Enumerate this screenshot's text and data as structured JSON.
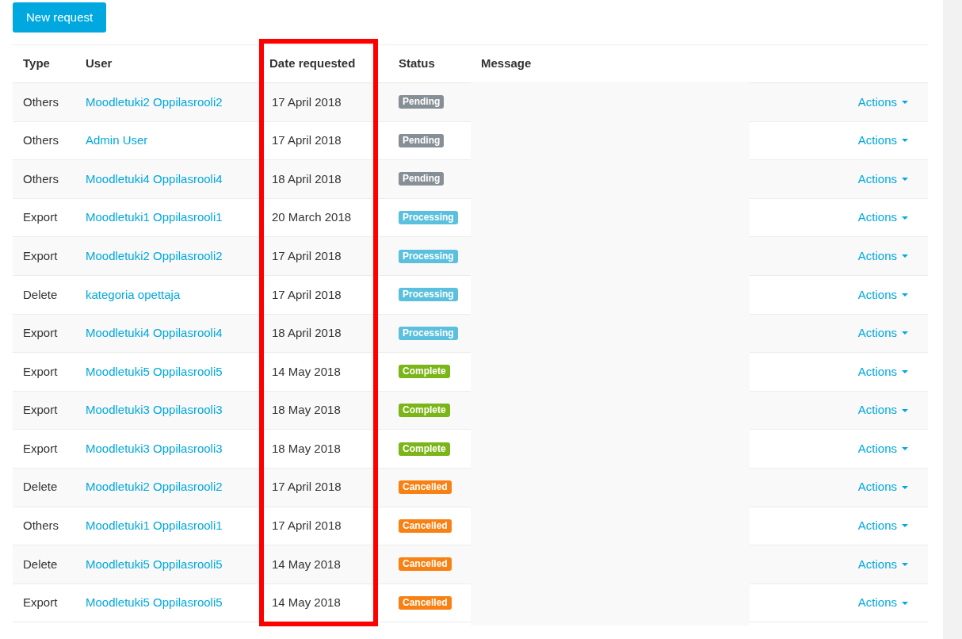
{
  "new_request_button": "New request",
  "table": {
    "columns": [
      {
        "label": "Type",
        "highlighted": false
      },
      {
        "label": "User",
        "highlighted": false
      },
      {
        "label": "Date requested",
        "highlighted": true
      },
      {
        "label": "Status",
        "highlighted": false
      },
      {
        "label": "Message",
        "highlighted": false
      }
    ],
    "rows": [
      {
        "type": "Others",
        "user": "Moodletuki2 Oppilasrooli2",
        "date": "17 April 2018",
        "status": {
          "label": "Pending",
          "color": "#868e96"
        },
        "actions": "Actions"
      },
      {
        "type": "Others",
        "user": "Admin User",
        "date": "17 April 2018",
        "status": {
          "label": "Pending",
          "color": "#868e96"
        },
        "actions": "Actions"
      },
      {
        "type": "Others",
        "user": "Moodletuki4 Oppilasrooli4",
        "date": "18 April 2018",
        "status": {
          "label": "Pending",
          "color": "#868e96"
        },
        "actions": "Actions"
      },
      {
        "type": "Export",
        "user": "Moodletuki1 Oppilasrooli1",
        "date": "20 March 2018",
        "status": {
          "label": "Processing",
          "color": "#5bc0de"
        },
        "actions": "Actions"
      },
      {
        "type": "Export",
        "user": "Moodletuki2 Oppilasrooli2",
        "date": "17 April 2018",
        "status": {
          "label": "Processing",
          "color": "#5bc0de"
        },
        "actions": "Actions"
      },
      {
        "type": "Delete",
        "user": "kategoria opettaja",
        "date": "17 April 2018",
        "status": {
          "label": "Processing",
          "color": "#5bc0de"
        },
        "actions": "Actions"
      },
      {
        "type": "Export",
        "user": "Moodletuki4 Oppilasrooli4",
        "date": "18 April 2018",
        "status": {
          "label": "Processing",
          "color": "#5bc0de"
        },
        "actions": "Actions"
      },
      {
        "type": "Export",
        "user": "Moodletuki5 Oppilasrooli5",
        "date": "14 May 2018",
        "status": {
          "label": "Complete",
          "color": "#7cb518"
        },
        "actions": "Actions"
      },
      {
        "type": "Export",
        "user": "Moodletuki3 Oppilasrooli3",
        "date": "18 May 2018",
        "status": {
          "label": "Complete",
          "color": "#7cb518"
        },
        "actions": "Actions"
      },
      {
        "type": "Export",
        "user": "Moodletuki3 Oppilasrooli3",
        "date": "18 May 2018",
        "status": {
          "label": "Complete",
          "color": "#7cb518"
        },
        "actions": "Actions"
      },
      {
        "type": "Delete",
        "user": "Moodletuki2 Oppilasrooli2",
        "date": "17 April 2018",
        "status": {
          "label": "Cancelled",
          "color": "#f98012"
        },
        "actions": "Actions"
      },
      {
        "type": "Others",
        "user": "Moodletuki1 Oppilasrooli1",
        "date": "17 April 2018",
        "status": {
          "label": "Cancelled",
          "color": "#f98012"
        },
        "actions": "Actions"
      },
      {
        "type": "Delete",
        "user": "Moodletuki5 Oppilasrooli5",
        "date": "14 May 2018",
        "status": {
          "label": "Cancelled",
          "color": "#f98012"
        },
        "actions": "Actions"
      },
      {
        "type": "Export",
        "user": "Moodletuki5 Oppilasrooli5",
        "date": "14 May 2018",
        "status": {
          "label": "Cancelled",
          "color": "#f98012"
        },
        "actions": "Actions"
      }
    ]
  }
}
